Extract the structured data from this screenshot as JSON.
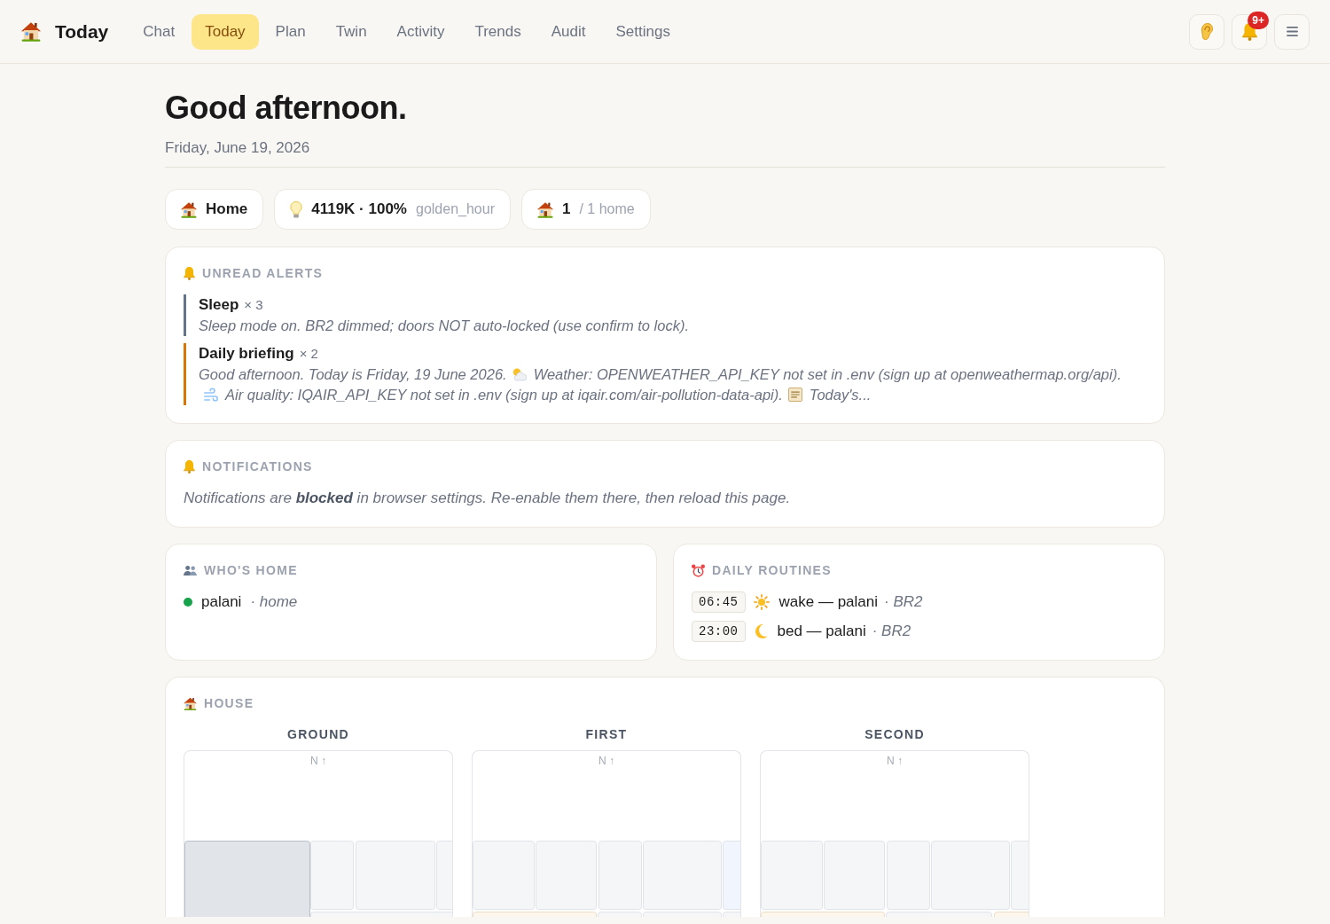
{
  "nav": {
    "brand": "Today",
    "links": [
      {
        "label": "Chat",
        "selected": false
      },
      {
        "label": "Today",
        "selected": true
      },
      {
        "label": "Plan",
        "selected": false
      },
      {
        "label": "Twin",
        "selected": false
      },
      {
        "label": "Activity",
        "selected": false
      },
      {
        "label": "Trends",
        "selected": false
      },
      {
        "label": "Audit",
        "selected": false
      },
      {
        "label": "Settings",
        "selected": false
      }
    ]
  },
  "toolbar": [
    {
      "kind": "ear"
    },
    {
      "kind": "bell",
      "badge": "9+"
    },
    {
      "kind": "menu"
    }
  ],
  "greeting": "Good afternoon.",
  "date": "Friday, June 19, 2026",
  "chips": [
    {
      "kind": "place",
      "value": "Home"
    },
    {
      "kind": "light",
      "value": "4119K · 100%",
      "note": "golden_hour"
    },
    {
      "kind": "homes",
      "value": "1",
      "note": "/ 1 home"
    }
  ],
  "alerts": {
    "title": "UNREAD ALERTS",
    "items": [
      {
        "title": "Sleep",
        "count": "× 3",
        "color": "#64748b",
        "message": [
          {
            "kind": "plain",
            "text": "Sleep mode on. BR2 dimmed; doors NOT auto-locked (use confirm to lock)."
          }
        ]
      },
      {
        "title": "Daily briefing",
        "count": "× 2",
        "color": "#d97706",
        "message": [
          {
            "kind": "plain",
            "text": "Good afternoon. Today is Friday, 19 June 2026."
          },
          {
            "kind": "weather",
            "text": "Weather: OPENWEATHER_API_KEY not set in .env (sign up at openweathermap.org/api)."
          },
          {
            "kind": "air",
            "text": "Air quality: IQAIR_API_KEY not set in .env (sign up at iqair.com/air-pollution-data-api)."
          },
          {
            "kind": "news",
            "text": "Today's..."
          }
        ]
      }
    ]
  },
  "notifications": {
    "title": "NOTIFICATIONS",
    "text": "Notifications are **blocked** in browser settings. Re-enable them there, then reload this page."
  },
  "whos_home": {
    "title": "WHO'S HOME",
    "people": [
      {
        "name": "palani",
        "location": "· home",
        "color": "#16a34a"
      }
    ]
  },
  "routines": {
    "title": "DAILY ROUTINES",
    "items": [
      {
        "time": "06:45",
        "kind": "wake",
        "label": "wake — palani",
        "room": "· BR2"
      },
      {
        "time": "23:00",
        "kind": "bed",
        "label": "bed — palani",
        "room": "· BR2"
      }
    ]
  },
  "house": {
    "title": "HOUSE",
    "floors": [
      {
        "name": "GROUND",
        "compass": "N ↑"
      },
      {
        "name": "FIRST",
        "compass": "N ↑"
      },
      {
        "name": "SECOND",
        "compass": "N ↑"
      }
    ]
  }
}
